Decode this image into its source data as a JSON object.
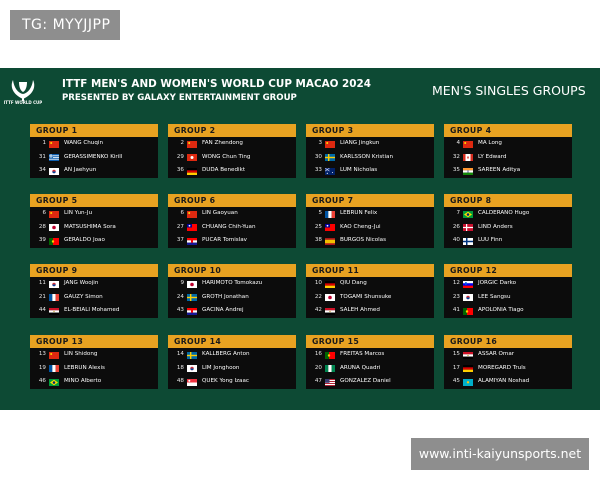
{
  "watermark_top": "TG: MYYJJPP",
  "watermark_url": "www.inti-kaiyunsports.net",
  "colors": {
    "board_bg": "#0d4a34",
    "group_header": "#e8a221",
    "card_bg": "#0c0c0c"
  },
  "logo": {
    "icon": "ittf-world-cup-trophy-icon",
    "text": "ITTF WORLD CUP"
  },
  "event": {
    "title": "ITTF MEN'S AND WOMEN'S WORLD CUP MACAO 2024",
    "subtitle": "PRESENTED BY GALAXY ENTERTAINMENT GROUP"
  },
  "board_title": "MEN'S SINGLES GROUPS",
  "groups": [
    {
      "name": "GROUP 1",
      "players": [
        {
          "seed": "1",
          "flag": "CHN",
          "name": "WANG Chuqin"
        },
        {
          "seed": "31",
          "flag": "GRE",
          "name": "GERASSIMENKO Kirill"
        },
        {
          "seed": "34",
          "flag": "KOR",
          "name": "AN Jaehyun"
        }
      ]
    },
    {
      "name": "GROUP 2",
      "players": [
        {
          "seed": "2",
          "flag": "CHN",
          "name": "FAN Zhendong"
        },
        {
          "seed": "29",
          "flag": "HKG",
          "name": "WONG Chun Ting"
        },
        {
          "seed": "36",
          "flag": "GER",
          "name": "DUDA Benedikt"
        }
      ]
    },
    {
      "name": "GROUP 3",
      "players": [
        {
          "seed": "3",
          "flag": "CHN",
          "name": "LIANG Jingkun"
        },
        {
          "seed": "30",
          "flag": "SWE",
          "name": "KARLSSON Kristian"
        },
        {
          "seed": "33",
          "flag": "AUS",
          "name": "LUM Nicholas"
        }
      ]
    },
    {
      "name": "GROUP 4",
      "players": [
        {
          "seed": "4",
          "flag": "CHN",
          "name": "MA Long"
        },
        {
          "seed": "32",
          "flag": "CAN",
          "name": "LY Edward"
        },
        {
          "seed": "35",
          "flag": "IND",
          "name": "SAREEN Aditya"
        }
      ]
    },
    {
      "name": "GROUP 5",
      "players": [
        {
          "seed": "6",
          "flag": "CHN",
          "name": "LIN Yun-Ju"
        },
        {
          "seed": "28",
          "flag": "JPN",
          "name": "MATSUSHIMA Sora"
        },
        {
          "seed": "39",
          "flag": "POR",
          "name": "GERALDO Joao"
        }
      ]
    },
    {
      "name": "GROUP 6",
      "players": [
        {
          "seed": "6",
          "flag": "CHN",
          "name": "LIN Gaoyuan"
        },
        {
          "seed": "27",
          "flag": "TPE",
          "name": "CHUANG Chih-Yuan"
        },
        {
          "seed": "37",
          "flag": "CRO",
          "name": "PUCAR Tomislav"
        }
      ]
    },
    {
      "name": "GROUP 7",
      "players": [
        {
          "seed": "5",
          "flag": "FRA",
          "name": "LEBRUN Felix"
        },
        {
          "seed": "25",
          "flag": "TPE",
          "name": "KAO Cheng-Jui"
        },
        {
          "seed": "38",
          "flag": "ESP",
          "name": "BURGOS Nicolas"
        }
      ]
    },
    {
      "name": "GROUP 8",
      "players": [
        {
          "seed": "7",
          "flag": "BRA",
          "name": "CALDERANO Hugo"
        },
        {
          "seed": "26",
          "flag": "DEN",
          "name": "LIND Anders"
        },
        {
          "seed": "40",
          "flag": "FIN",
          "name": "LUU Finn"
        }
      ]
    },
    {
      "name": "GROUP 9",
      "players": [
        {
          "seed": "11",
          "flag": "KOR",
          "name": "JANG Woojin"
        },
        {
          "seed": "21",
          "flag": "FRA",
          "name": "GAUZY Simon"
        },
        {
          "seed": "44",
          "flag": "EGY",
          "name": "EL-BEIALI Mohamed"
        }
      ]
    },
    {
      "name": "GROUP 10",
      "players": [
        {
          "seed": "9",
          "flag": "JPN",
          "name": "HARIMOTO Tomokazu"
        },
        {
          "seed": "24",
          "flag": "SWE",
          "name": "GROTH Jonathan"
        },
        {
          "seed": "43",
          "flag": "CRO",
          "name": "GACINA Andrej"
        }
      ]
    },
    {
      "name": "GROUP 11",
      "players": [
        {
          "seed": "10",
          "flag": "GER",
          "name": "QIU Dang"
        },
        {
          "seed": "22",
          "flag": "JPN",
          "name": "TOGAMI Shunsuke"
        },
        {
          "seed": "42",
          "flag": "EGY",
          "name": "SALEH Ahmed"
        }
      ]
    },
    {
      "name": "GROUP 12",
      "players": [
        {
          "seed": "12",
          "flag": "SLO",
          "name": "JORGIC Darko"
        },
        {
          "seed": "23",
          "flag": "KOR",
          "name": "LEE Sangsu"
        },
        {
          "seed": "41",
          "flag": "POR",
          "name": "APOLONIA Tiago"
        }
      ]
    },
    {
      "name": "GROUP 13",
      "players": [
        {
          "seed": "13",
          "flag": "CHN",
          "name": "LIN Shidong"
        },
        {
          "seed": "19",
          "flag": "FRA",
          "name": "LEBRUN Alexis"
        },
        {
          "seed": "46",
          "flag": "BRA",
          "name": "MINO Alberto"
        }
      ]
    },
    {
      "name": "GROUP 14",
      "players": [
        {
          "seed": "14",
          "flag": "SWE",
          "name": "KALLBERG Anton"
        },
        {
          "seed": "18",
          "flag": "KOR",
          "name": "LIM Jonghoon"
        },
        {
          "seed": "48",
          "flag": "SGP",
          "name": "QUEK Yong Izaac"
        }
      ]
    },
    {
      "name": "GROUP 15",
      "players": [
        {
          "seed": "16",
          "flag": "POR",
          "name": "FREITAS Marcos"
        },
        {
          "seed": "20",
          "flag": "NGR",
          "name": "ARUNA Quadri"
        },
        {
          "seed": "47",
          "flag": "USA",
          "name": "GONZALEZ Daniel"
        }
      ]
    },
    {
      "name": "GROUP 16",
      "players": [
        {
          "seed": "15",
          "flag": "EGY",
          "name": "ASSAR Omar"
        },
        {
          "seed": "17",
          "flag": "GER",
          "name": "MOREGARD Truls"
        },
        {
          "seed": "45",
          "flag": "KAZ",
          "name": "ALAMIYAN Noshad"
        }
      ]
    }
  ]
}
